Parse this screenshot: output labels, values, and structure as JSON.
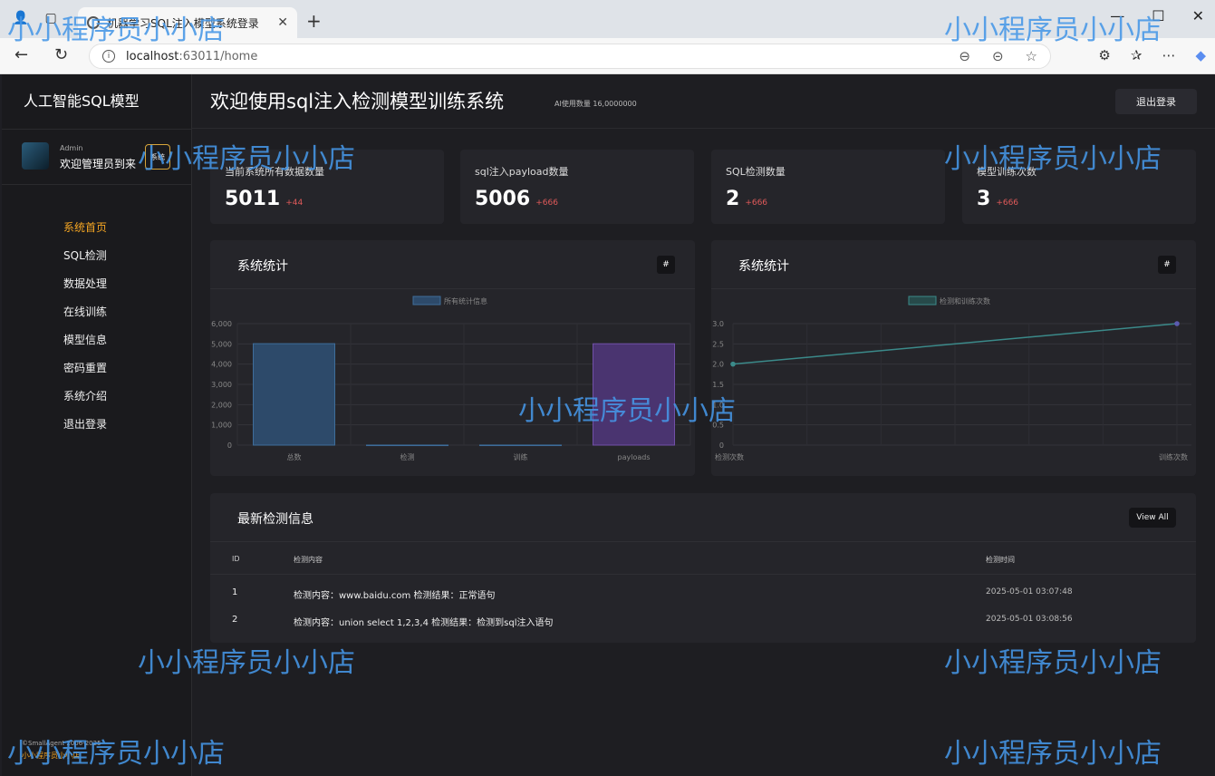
{
  "browser": {
    "tab_title": "机器学习SQL注入模型系统登录",
    "url_host": "localhost",
    "url_rest": ":63011/home",
    "new_tab": "+",
    "controls": {
      "minimize": "—",
      "maximize": "☐",
      "close": "✕"
    }
  },
  "sidebar": {
    "brand": "人工智能SQL模型",
    "user_role": "Admin",
    "user_welcome": "欢迎管理员到来",
    "user_badge": "系统",
    "items": [
      {
        "label": "系统首页",
        "active": true
      },
      {
        "label": "SQL检测"
      },
      {
        "label": "数据处理"
      },
      {
        "label": "在线训练"
      },
      {
        "label": "模型信息"
      },
      {
        "label": "密码重置"
      },
      {
        "label": "系统介绍"
      },
      {
        "label": "退出登录"
      }
    ],
    "footer_copy": "©SmallAgent 2006-2025",
    "footer_link": "小小程序员小小店"
  },
  "header": {
    "title": "欢迎使用sql注入检测模型训练系统",
    "ai_count": "AI使用数量 16,0000000",
    "logout": "退出登录"
  },
  "stats": [
    {
      "label": "当前系统所有数据数量",
      "value": "5011",
      "delta": "+44"
    },
    {
      "label": "sql注入payload数量",
      "value": "5006",
      "delta": "+666"
    },
    {
      "label": "SQL检测数量",
      "value": "2",
      "delta": "+666"
    },
    {
      "label": "模型训练次数",
      "value": "3",
      "delta": "+666"
    }
  ],
  "panels": {
    "left_title": "系统统计",
    "right_title": "系统统计",
    "btn": "#"
  },
  "chart_data": [
    {
      "type": "bar",
      "legend": "所有统计信息",
      "categories": [
        "总数",
        "检测",
        "训练",
        "payloads"
      ],
      "values": [
        5011,
        2,
        3,
        5006
      ],
      "ylim": [
        0,
        6000
      ],
      "yticks": [
        0,
        1000,
        2000,
        3000,
        4000,
        5000,
        6000
      ],
      "colors": [
        "#2d4a6a",
        "#2d4a6a",
        "#2d4a6a",
        "#4a3470"
      ],
      "stroke_colors": [
        "#3e6d9a",
        "#3e6d9a",
        "#3e6d9a",
        "#7150a8"
      ],
      "grid": true
    },
    {
      "type": "line",
      "legend": "检测和训练次数",
      "categories": [
        "检测次数",
        "训练次数"
      ],
      "values": [
        2,
        3
      ],
      "ylim": [
        0,
        3
      ],
      "yticks": [
        0,
        0.5,
        1.0,
        1.5,
        2.0,
        2.5,
        3.0
      ],
      "color": "#3b8a8a",
      "grid": true
    }
  ],
  "detections": {
    "title": "最新检测信息",
    "view_all": "View All",
    "headers": {
      "id": "ID",
      "content": "检测内容",
      "time": "检测时间"
    },
    "rows": [
      {
        "id": "1",
        "content": "检测内容：www.baidu.com 检测结果：正常语句",
        "time": "2025-05-01 03:07:48"
      },
      {
        "id": "2",
        "content": "检测内容：union select 1,2,3,4 检测结果：检测到sql注入语句",
        "time": "2025-05-01 03:08:56"
      }
    ]
  },
  "watermark": "小小程序员小小店"
}
